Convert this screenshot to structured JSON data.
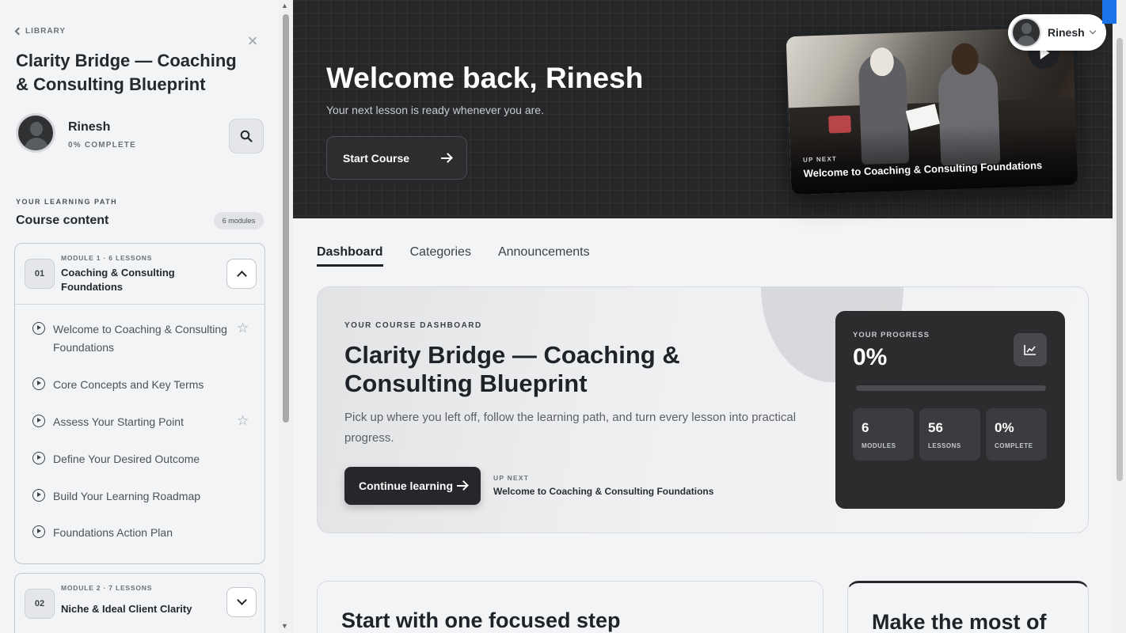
{
  "sidebar": {
    "back_label": "LIBRARY",
    "course_title": "Clarity Bridge — Coaching & Consulting Blueprint",
    "user_name": "Rinesh",
    "user_progress": "0% COMPLETE",
    "learning_path_label": "YOUR LEARNING PATH",
    "course_content_title": "Course content",
    "modules_count": "6 modules",
    "modules": [
      {
        "number": "01",
        "meta": "MODULE 1 · 6 LESSONS",
        "name": "Coaching & Consulting Foundations",
        "expanded": true,
        "lessons": [
          {
            "title": "Welcome to Coaching & Consulting Foundations",
            "starred": true
          },
          {
            "title": "Core Concepts and Key Terms",
            "starred": false
          },
          {
            "title": "Assess Your Starting Point",
            "starred": true
          },
          {
            "title": "Define Your Desired Outcome",
            "starred": false
          },
          {
            "title": "Build Your Learning Roadmap",
            "starred": false
          },
          {
            "title": "Foundations Action Plan",
            "starred": false
          }
        ]
      },
      {
        "number": "02",
        "meta": "MODULE 2 · 7 LESSONS",
        "name": "Niche & Ideal Client Clarity",
        "expanded": false
      }
    ]
  },
  "hero": {
    "title": "Welcome back, Rinesh",
    "subtitle": "Your next lesson is ready whenever you are.",
    "start_button": "Start Course",
    "video_up_next_label": "UP NEXT",
    "video_title": "Welcome to Coaching & Consulting Foundations"
  },
  "user_menu": {
    "name": "Rinesh"
  },
  "tabs": [
    {
      "label": "Dashboard",
      "active": true
    },
    {
      "label": "Categories",
      "active": false
    },
    {
      "label": "Announcements",
      "active": false
    }
  ],
  "dashboard": {
    "label": "YOUR COURSE DASHBOARD",
    "title": "Clarity Bridge — Coaching & Consulting Blueprint",
    "description": "Pick up where you left off, follow the learning path, and turn every lesson into practical progress.",
    "continue_button": "Continue learning",
    "up_next_label": "UP NEXT",
    "up_next_value": "Welcome to Coaching & Consulting Foundations",
    "progress": {
      "label": "YOUR PROGRESS",
      "value": "0%",
      "fraction": 0,
      "stats": [
        {
          "num": "6",
          "label": "MODULES"
        },
        {
          "num": "56",
          "label": "LESSONS"
        },
        {
          "num": "0%",
          "label": "COMPLETE"
        }
      ]
    }
  },
  "bottom_cards": [
    {
      "title": "Start with one focused step"
    },
    {
      "title": "Make the most of"
    }
  ],
  "icons": {
    "back": "chevron-left-icon",
    "close": "close-icon",
    "search": "search-icon",
    "play": "play-circle-icon",
    "star": "star-icon",
    "chart": "chart-icon",
    "arrow": "arrow-right-icon"
  }
}
